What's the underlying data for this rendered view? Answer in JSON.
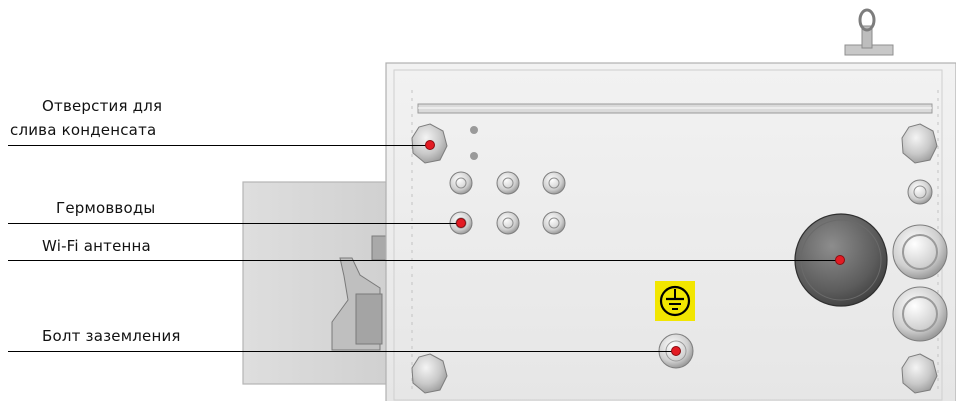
{
  "callouts": [
    {
      "id": "drain",
      "lines": [
        "Отверстия для",
        "слива конденсата"
      ]
    },
    {
      "id": "glands",
      "lines": [
        "Гермовводы"
      ]
    },
    {
      "id": "wifi",
      "lines": [
        "Wi-Fi антенна"
      ]
    },
    {
      "id": "ground",
      "lines": [
        "Болт заземления"
      ]
    }
  ],
  "colors": {
    "marker": "#e31b23",
    "ground_symbol_bg": "#f2e600",
    "enclosure_fill": "#ececec",
    "line": "#000000"
  },
  "icons": {
    "ground_symbol": "earth-ground-icon"
  }
}
